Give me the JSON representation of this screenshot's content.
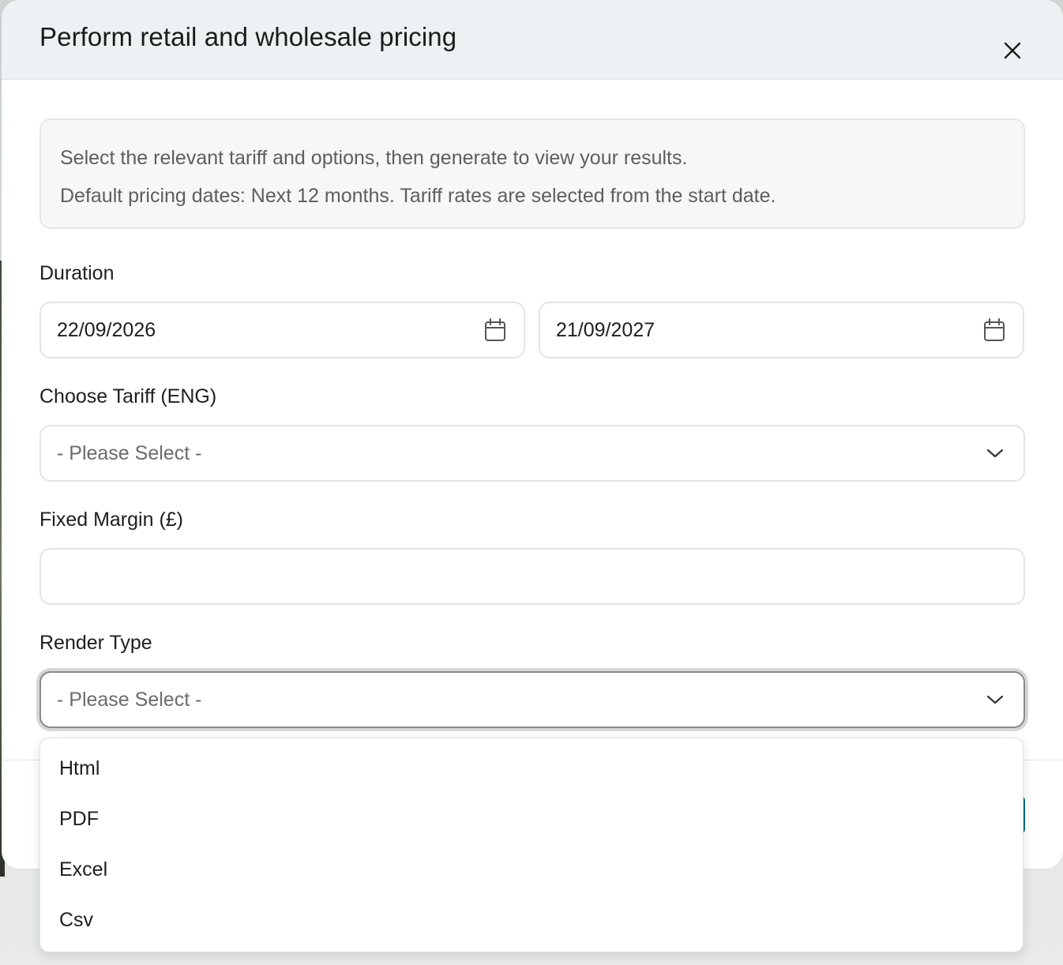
{
  "modal": {
    "title": "Perform retail and wholesale pricing"
  },
  "info": {
    "line1": "Select the relevant tariff and options, then generate to view your results.",
    "line2": "Default pricing dates: Next 12 months. Tariff rates are selected from the start date."
  },
  "duration": {
    "label": "Duration",
    "start_date": "22/09/2026",
    "end_date": "21/09/2027"
  },
  "tariff": {
    "label": "Choose Tariff (ENG)",
    "selected": "- Please Select -"
  },
  "margin": {
    "label": "Fixed Margin (£)",
    "value": ""
  },
  "render_type": {
    "label": "Render Type",
    "selected": "- Please Select -",
    "options": [
      "Html",
      "PDF",
      "Excel",
      "Csv"
    ]
  },
  "icons": {
    "close": "close-icon",
    "calendar": "calendar-icon",
    "chevron": "chevron-down-icon"
  }
}
